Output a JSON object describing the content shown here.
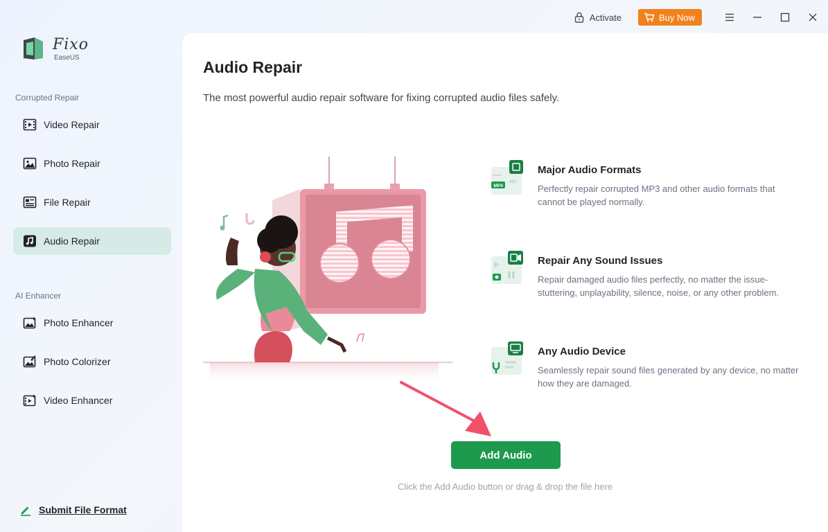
{
  "app": {
    "brand": "Fixo",
    "brand_sub": "EaseUS"
  },
  "topbar": {
    "activate_label": "Activate",
    "buy_label": "Buy Now"
  },
  "sidebar": {
    "section_corrupted": "Corrupted Repair",
    "corrupted_items": [
      {
        "label": "Video Repair",
        "icon": "video-icon"
      },
      {
        "label": "Photo Repair",
        "icon": "photo-icon"
      },
      {
        "label": "File Repair",
        "icon": "file-icon"
      },
      {
        "label": "Audio Repair",
        "icon": "audio-icon",
        "active": true
      }
    ],
    "section_ai": "AI Enhancer",
    "ai_items": [
      {
        "label": "Photo Enhancer",
        "icon": "photo-enhance-icon"
      },
      {
        "label": "Photo Colorizer",
        "icon": "photo-colorize-icon"
      },
      {
        "label": "Video Enhancer",
        "icon": "video-enhance-icon"
      }
    ],
    "submit_label": "Submit File Format"
  },
  "main": {
    "title": "Audio Repair",
    "subtitle": "The most powerful audio repair software for fixing corrupted audio files safely.",
    "features": [
      {
        "title": "Major Audio Formats",
        "description": "Perfectly repair corrupted MP3 and other audio formats that cannot be played normally.",
        "icon": "audio-formats-icon",
        "badges": [
          "MP4",
          "AVI"
        ]
      },
      {
        "title": "Repair Any Sound Issues",
        "description": "Repair damaged audio files perfectly, no matter the issue- stuttering, unplayability, silence, noise, or any other problem.",
        "icon": "sound-issues-icon"
      },
      {
        "title": "Any Audio Device",
        "description": "Seamlessly repair sound files generated by any device, no matter how they are damaged.",
        "icon": "audio-device-icon"
      }
    ],
    "add_button": "Add Audio",
    "hint": "Click the Add Audio button or drag & drop the file here"
  },
  "colors": {
    "accent": "#1e9a4e",
    "buy": "#f0821e",
    "active_nav": "#d7ebe6",
    "pink": "#e98a98"
  }
}
